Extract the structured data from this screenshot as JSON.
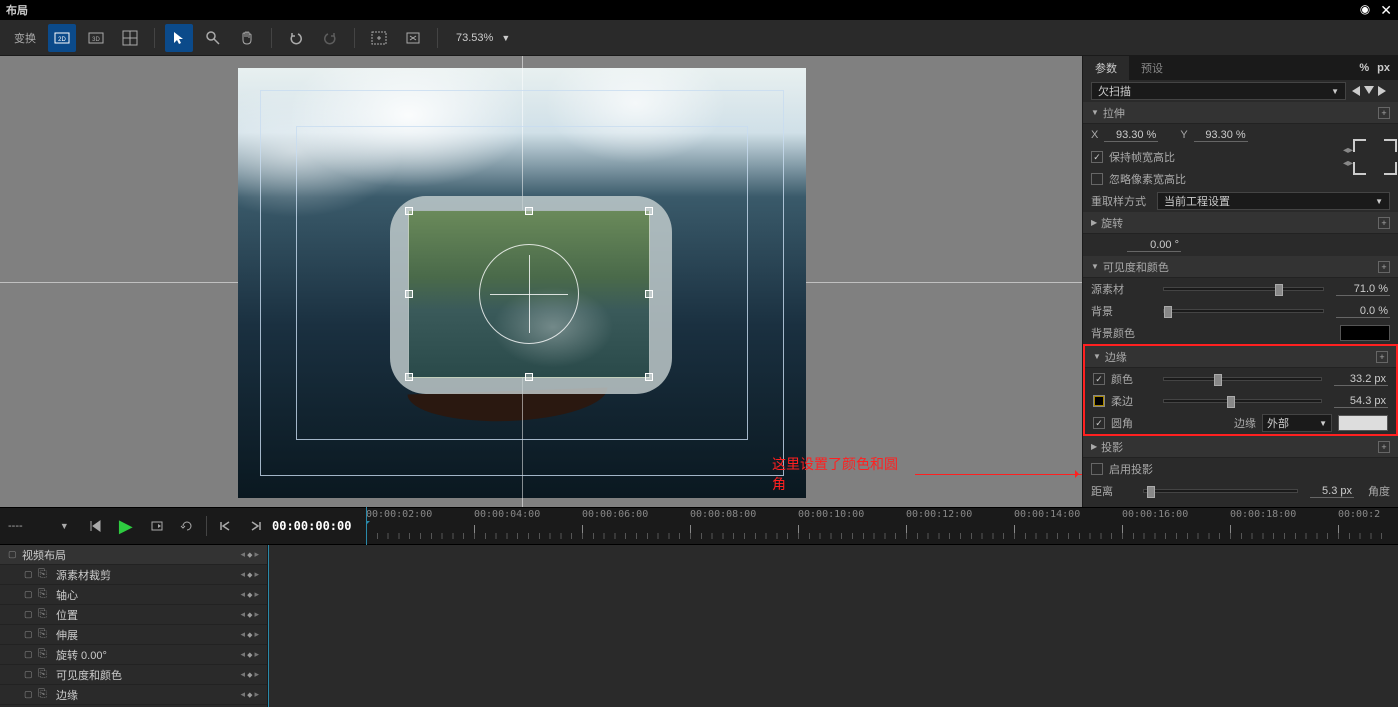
{
  "window": {
    "title": "布局"
  },
  "toolbar": {
    "transform_label": "变换",
    "zoom": "73.53%"
  },
  "annotation": "这里设置了颜色和圆角",
  "panel": {
    "tabs": {
      "params": "参数",
      "presets": "预设",
      "pct": "%",
      "px": "px"
    },
    "overscan_label": "欠扫描",
    "stretch": {
      "title": "拉伸",
      "x_label": "X",
      "x_val": "93.30 %",
      "y_label": "Y",
      "y_val": "93.30 %",
      "keep_aspect": "保持帧宽高比",
      "ignore_par": "忽略像素宽高比"
    },
    "resample": {
      "label": "重取样方式",
      "value": "当前工程设置"
    },
    "rotate": {
      "title": "旋转",
      "value": "0.00 °"
    },
    "visibility": {
      "title": "可见度和颜色",
      "source": "源素材",
      "source_val": "71.0 %",
      "bg": "背景",
      "bg_val": "0.0 %",
      "bg_color": "背景颜色"
    },
    "border": {
      "title": "边缘",
      "color": "颜色",
      "color_val": "33.2 px",
      "soft": "柔边",
      "soft_val": "54.3 px",
      "rounded": "圆角",
      "edge": "边缘",
      "edge_mode": "外部"
    },
    "shadow": {
      "title": "投影",
      "enable": "启用投影",
      "distance": "距离",
      "distance_val": "5.3 px",
      "angle": "角度"
    }
  },
  "timeline": {
    "current": "00:00:00:00",
    "marks": [
      "00:00:02:00",
      "00:00:04:00",
      "00:00:06:00",
      "00:00:08:00",
      "00:00:10:00",
      "00:00:12:00",
      "00:00:14:00",
      "00:00:16:00",
      "00:00:18:00",
      "00:00:2"
    ],
    "selector": "----",
    "tracks": {
      "root": "视频布局",
      "items": [
        {
          "name": "源素材裁剪"
        },
        {
          "name": "轴心"
        },
        {
          "name": "位置"
        },
        {
          "name": "伸展"
        },
        {
          "name": "旋转",
          "extra": "0.00°"
        },
        {
          "name": "可见度和颜色"
        },
        {
          "name": "边缘"
        }
      ]
    }
  }
}
